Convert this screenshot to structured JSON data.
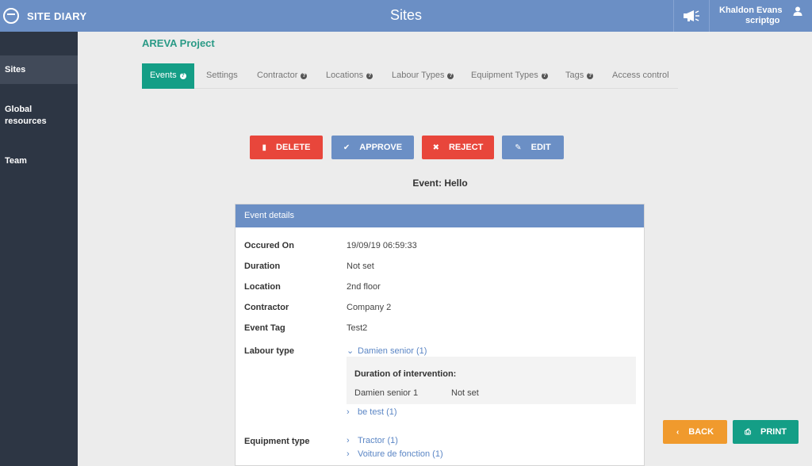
{
  "app": {
    "brand": "SITE DIARY",
    "title": "Sites"
  },
  "user": {
    "name": "Khaldon Evans",
    "org": "scriptgo"
  },
  "sidebar": {
    "items": [
      {
        "label": "Sites"
      },
      {
        "label": "Global resources"
      },
      {
        "label": "Team"
      }
    ]
  },
  "project": {
    "name": "AREVA Project"
  },
  "tabs": [
    {
      "label": "Events",
      "help": true
    },
    {
      "label": "Settings",
      "help": false
    },
    {
      "label": "Contractor",
      "help": true
    },
    {
      "label": "Locations",
      "help": true
    },
    {
      "label": "Labour Types",
      "help": true
    },
    {
      "label": "Equipment Types",
      "help": true
    },
    {
      "label": "Tags",
      "help": true
    },
    {
      "label": "Access control",
      "help": false
    }
  ],
  "actions": {
    "delete": "DELETE",
    "approve": "APPROVE",
    "reject": "REJECT",
    "edit": "EDIT"
  },
  "event": {
    "title": "Event: Hello",
    "panel_title": "Event details",
    "fields": [
      {
        "label": "Occured On",
        "value": "19/09/19 06:59:33"
      },
      {
        "label": "Duration",
        "value": "Not set"
      },
      {
        "label": "Location",
        "value": "2nd floor"
      },
      {
        "label": "Contractor",
        "value": "Company 2"
      },
      {
        "label": "Event Tag",
        "value": "Test2"
      }
    ],
    "labour_label": "Labour type",
    "labour_items": [
      "Damien senior (1)",
      "be test (1)"
    ],
    "intervention": {
      "heading": "Duration of intervention:",
      "name": "Damien senior 1",
      "value": "Not set"
    },
    "equipment_label": "Equipment type",
    "equipment_items": [
      "Tractor (1)",
      "Voiture de fonction (1)"
    ]
  },
  "footer": {
    "back": "BACK",
    "print": "PRINT"
  },
  "colors": {
    "primary": "#6b8fc5",
    "accent": "#149e86",
    "danger": "#e8463b",
    "warning": "#f09a2d",
    "sidebar": "#2d3644"
  },
  "icons": [
    "helmet-icon",
    "megaphone-icon",
    "user-icon",
    "help-icon",
    "trash-icon",
    "check-icon",
    "x-icon",
    "edit-icon",
    "chevron-down-icon",
    "chevron-right-icon",
    "chevron-left-icon",
    "print-icon"
  ]
}
